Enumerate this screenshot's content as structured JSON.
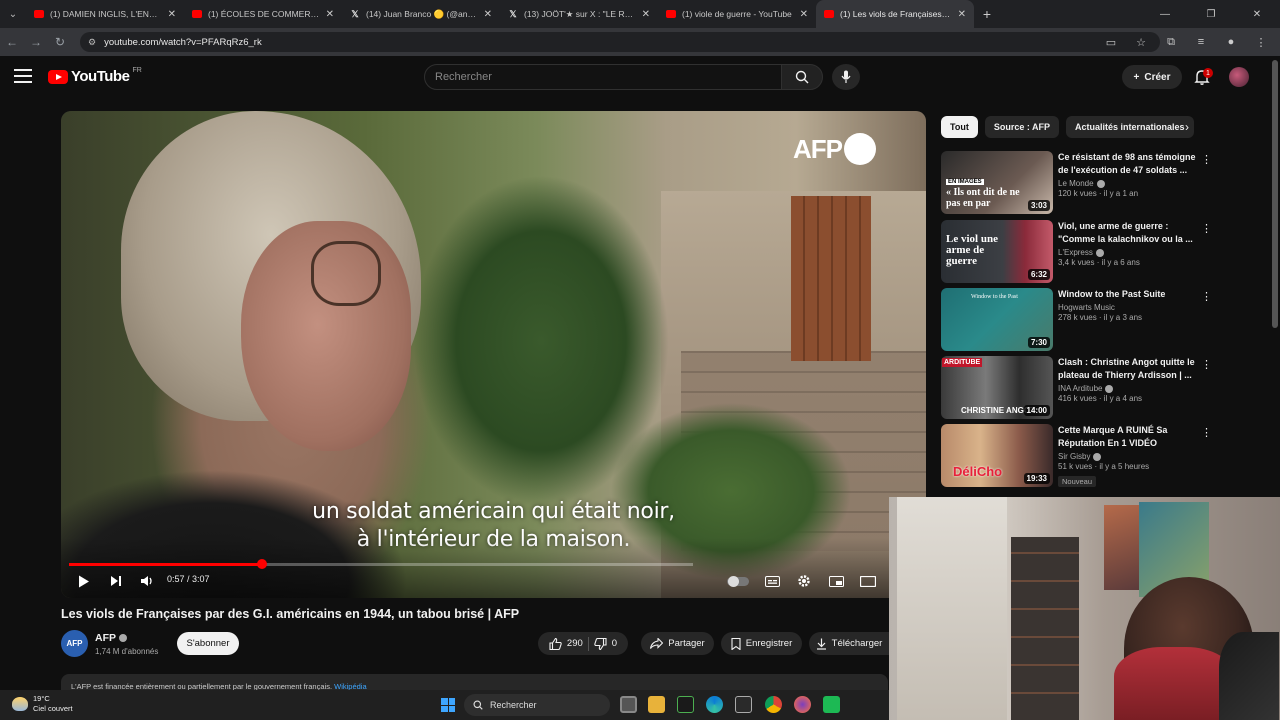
{
  "browser": {
    "tabs": [
      {
        "title": "(1) DAMIEN INGLIS, L'ENTRETIEN",
        "icon": "youtube-icon"
      },
      {
        "title": "(1) ÉCOLES DE COMMERCE : AU",
        "icon": "youtube-icon"
      },
      {
        "title": "(14) Juan Branco 🟡 (@anatolium",
        "icon": "x-icon"
      },
      {
        "title": "(13) JOÖT'★ sur X : \"LE RAP C'ES",
        "icon": "x-icon"
      },
      {
        "title": "(1) viole de guerre - YouTube",
        "icon": "youtube-icon"
      },
      {
        "title": "(1) Les viols de Françaises par des",
        "icon": "youtube-icon",
        "active": true
      }
    ],
    "url": "youtube.com/watch?v=PFARqRz6_rk"
  },
  "header": {
    "logo_text": "YouTube",
    "country_code": "FR",
    "search_placeholder": "Rechercher",
    "create_label": "Créer",
    "notification_count": "1"
  },
  "player": {
    "watermark": "AFP",
    "subtitle_line1": "un soldat américain qui était noir,",
    "subtitle_line2": "à l'intérieur de la maison.",
    "time": "0:57 / 3:07",
    "progress_fraction": 0.309
  },
  "video": {
    "title": "Les viols de Françaises par des G.I. américains en 1944, un tabou brisé | AFP",
    "channel_name": "AFP",
    "channel_avatar_text": "AFP",
    "subscribers": "1,74 M d'abonnés",
    "subscribe_label": "S'abonner",
    "likes": "290",
    "dislikes": "0",
    "share_label": "Partager",
    "save_label": "Enregistrer",
    "download_label": "Télécharger",
    "description": "L'AFP est financée entièrement ou partiellement par le gouvernement français.",
    "description_link": "Wikipédia"
  },
  "sidebar": {
    "chips": [
      "Tout",
      "Source : AFP",
      "Actualités internationales"
    ],
    "recommendations": [
      {
        "title": "Ce résistant de 98 ans témoigne de l'exécution de 47 soldats ...",
        "channel": "Le Monde",
        "meta": "120 k vues · il y a 1 an",
        "duration": "3:03",
        "thumb_text": "« Ils ont dit de ne pas en par",
        "thumb_tag": "EN IMAGES"
      },
      {
        "title": "Viol, une arme de guerre : \"Comme la kalachnikov ou la ...",
        "channel": "L'Express",
        "meta": "3,4 k vues · il y a 6 ans",
        "duration": "6:32",
        "thumb_text": "Le viol une arme de guerre"
      },
      {
        "title": "Window to the Past Suite",
        "channel": "Hogwarts Music",
        "meta": "278 k vues · il y a 3 ans",
        "duration": "7:30",
        "thumb_text": "Window to the Past"
      },
      {
        "title": "Clash : Christine Angot quitte le plateau de Thierry Ardisson | ...",
        "channel": "INA Arditube",
        "meta": "416 k vues · il y a 4 ans",
        "duration": "14:00",
        "thumb_text": "CHRISTINE ANGOT",
        "thumb_tag": "ARDITUBE"
      },
      {
        "title": "Cette Marque A RUINÉ Sa Réputation En 1 VIDÉO",
        "channel": "Sir Gisby",
        "meta": "51 k vues · il y a 5 heures",
        "duration": "19:33",
        "badge": "Nouveau",
        "thumb_text": "DéliCho"
      }
    ]
  },
  "taskbar": {
    "temperature": "19°C",
    "weather": "Ciel couvert",
    "search_label": "Rechercher"
  },
  "colors": {
    "accent": "#ff0000",
    "background": "#0f0f0f",
    "chip_bg": "#272727",
    "link": "#3ea6ff"
  }
}
